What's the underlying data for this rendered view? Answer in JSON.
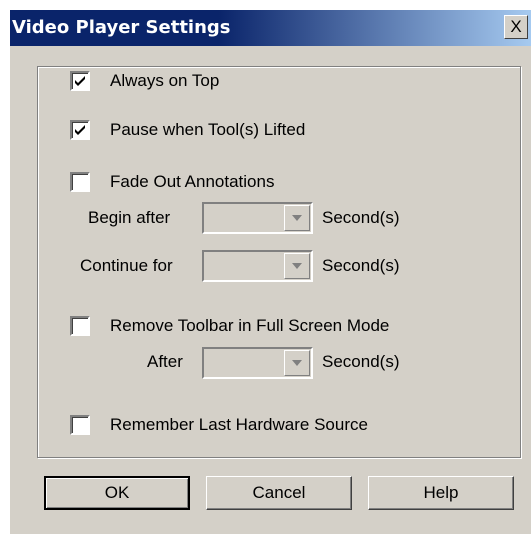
{
  "dialog": {
    "title": "Video Player Settings",
    "close_glyph": "X"
  },
  "options": {
    "always_on_top": {
      "label": "Always on Top",
      "checked": true
    },
    "pause_when_lifted": {
      "label": "Pause when Tool(s) Lifted",
      "checked": true
    },
    "fade_out_annotations": {
      "label": "Fade Out Annotations",
      "checked": false
    },
    "begin_after": {
      "label": "Begin after",
      "value": "",
      "unit": "Second(s)"
    },
    "continue_for": {
      "label": "Continue for",
      "value": "",
      "unit": "Second(s)"
    },
    "remove_toolbar": {
      "label": "Remove Toolbar in Full Screen Mode",
      "checked": false
    },
    "after": {
      "label": "After",
      "value": "",
      "unit": "Second(s)"
    },
    "remember_source": {
      "label": "Remember Last Hardware Source",
      "checked": false
    }
  },
  "buttons": {
    "ok": "OK",
    "cancel": "Cancel",
    "help": "Help"
  },
  "icons": {
    "check": "checkmark-icon",
    "dropdown": "chevron-down-icon",
    "close": "close-icon"
  }
}
